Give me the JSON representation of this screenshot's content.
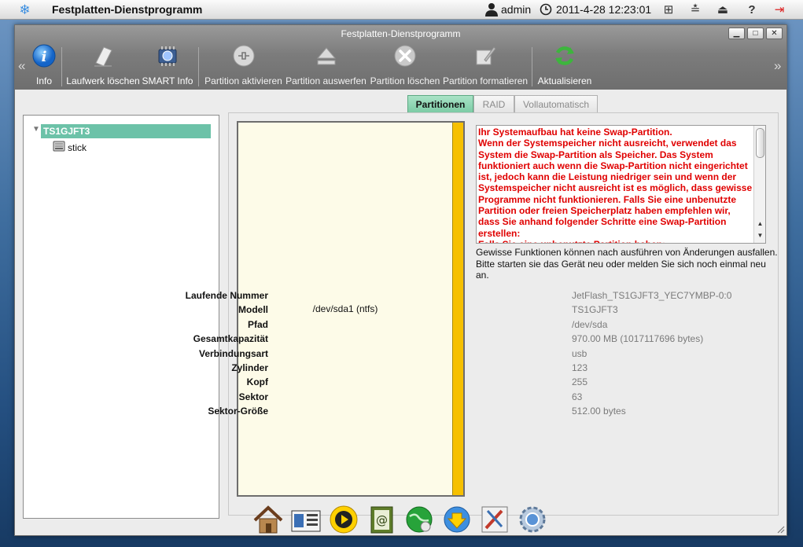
{
  "topbar": {
    "app_title": "Festplatten-Dienstprogramm",
    "user": "admin",
    "datetime": "2011-4-28 12:23:01",
    "logout_color": "#dd2222"
  },
  "window": {
    "title": "Festplatten-Dienstprogramm",
    "minimize": "▁",
    "maximize": "□",
    "close": "✕",
    "nav_left": "«",
    "nav_right": "»"
  },
  "toolbar": {
    "tools": [
      {
        "label": "Info",
        "icon": "info-icon",
        "enabled": true
      },
      {
        "label": "Laufwerk löschen",
        "icon": "eraser-icon",
        "enabled": true
      },
      {
        "label": "SMART Info",
        "icon": "smart-chip-icon",
        "enabled": true
      },
      {
        "label": "Partition aktivieren",
        "icon": "plug-icon",
        "enabled": false
      },
      {
        "label": "Partition auswerfen",
        "icon": "eject-icon",
        "enabled": false
      },
      {
        "label": "Partition löschen",
        "icon": "delete-x-icon",
        "enabled": false
      },
      {
        "label": "Partition formatieren",
        "icon": "format-pen-icon",
        "enabled": false
      },
      {
        "label": "Aktualisieren",
        "icon": "refresh-icon",
        "enabled": true
      }
    ]
  },
  "tabs": [
    {
      "label": "Partitionen",
      "active": true
    },
    {
      "label": "RAID",
      "active": false
    },
    {
      "label": "Vollautomatisch",
      "active": false
    }
  ],
  "tree": {
    "root": "TS1GJFT3",
    "child": "stick"
  },
  "partition": {
    "label": "/dev/sda1 (ntfs)",
    "bar_color": "#f6c000"
  },
  "warning": {
    "text": "Ihr Systemaufbau hat keine Swap-Partition.\nWenn der Systemspeicher nicht ausreicht, verwendet das System die Swap-Partition als Speicher. Das System funktioniert auch wenn die Swap-Partition nicht eingerichtet ist, jedoch kann die Leistung niedriger sein und wenn der Systemspeicher nicht ausreicht ist es möglich, dass gewisse Programme nicht funktionieren. Falls Sie eine unbenutzte Partition oder freien Speicherplatz haben empfehlen wir, dass Sie anhand folgender Schritte eine Swap-Partition erstellen:\nFalls Sie eine unbenutzte Partition haben:",
    "color": "#e00000"
  },
  "note": "Gewisse Funktionen können nach ausführen von Änderungen ausfallen. Bitte starten sie das Gerät neu oder melden Sie sich noch einmal neu an.",
  "properties": [
    {
      "key": "Laufende Nummer",
      "value": "JetFlash_TS1GJFT3_YEC7YMBP-0:0"
    },
    {
      "key": "Modell",
      "value": "TS1GJFT3"
    },
    {
      "key": "Pfad",
      "value": "/dev/sda"
    },
    {
      "key": "Gesamtkapazität",
      "value": "970.00 MB (1017117696 bytes)"
    },
    {
      "key": "Verbindungsart",
      "value": "usb"
    },
    {
      "key": "Zylinder",
      "value": "123"
    },
    {
      "key": "Kopf",
      "value": "255"
    },
    {
      "key": "Sektor",
      "value": "63"
    },
    {
      "key": "Sektor-Größe",
      "value": "512.00 bytes"
    }
  ],
  "dock": [
    {
      "icon": "home-icon"
    },
    {
      "icon": "file-manager-icon"
    },
    {
      "icon": "media-play-icon"
    },
    {
      "icon": "address-book-icon"
    },
    {
      "icon": "network-globe-icon"
    },
    {
      "icon": "download-icon"
    },
    {
      "icon": "settings-tools-icon"
    },
    {
      "icon": "system-gear-icon"
    }
  ]
}
